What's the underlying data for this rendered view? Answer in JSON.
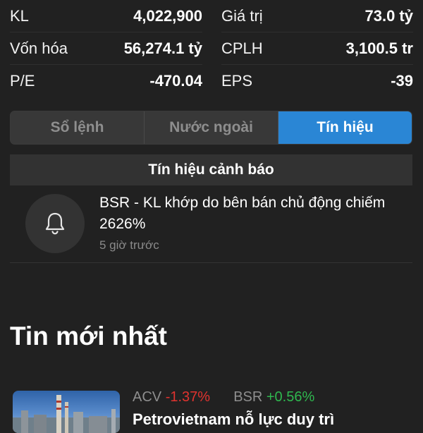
{
  "stats": {
    "left": [
      {
        "label": "KL",
        "value": "4,022,900"
      },
      {
        "label": "Vốn hóa",
        "value": "56,274.1 tỷ"
      },
      {
        "label": "P/E",
        "value": "-470.04"
      }
    ],
    "right": [
      {
        "label": "Giá trị",
        "value": "73.0 tỷ"
      },
      {
        "label": "CPLH",
        "value": "3,100.5 tr"
      },
      {
        "label": "EPS",
        "value": "-39"
      }
    ]
  },
  "tabs": [
    {
      "label": "Sổ lệnh",
      "active": false
    },
    {
      "label": "Nước ngoài",
      "active": false
    },
    {
      "label": "Tín hiệu",
      "active": true
    }
  ],
  "warnings": {
    "header": "Tín hiệu cảnh báo",
    "items": [
      {
        "icon": "bell-icon",
        "text": "BSR - KL khớp do bên bán chủ động chiếm 2626%",
        "time": "5 giờ trước"
      }
    ]
  },
  "news": {
    "title": "Tin mới nhất",
    "items": [
      {
        "tickers": [
          {
            "symbol": "ACV",
            "change": "-1.37%",
            "direction": "down"
          },
          {
            "symbol": "BSR",
            "change": "+0.56%",
            "direction": "up"
          }
        ],
        "headline": "Petrovietnam nỗ lực duy trì"
      }
    ]
  },
  "colors": {
    "background": "#212121",
    "accent": "#2a86d5",
    "negative": "#e0332f",
    "positive": "#2fb84f"
  }
}
